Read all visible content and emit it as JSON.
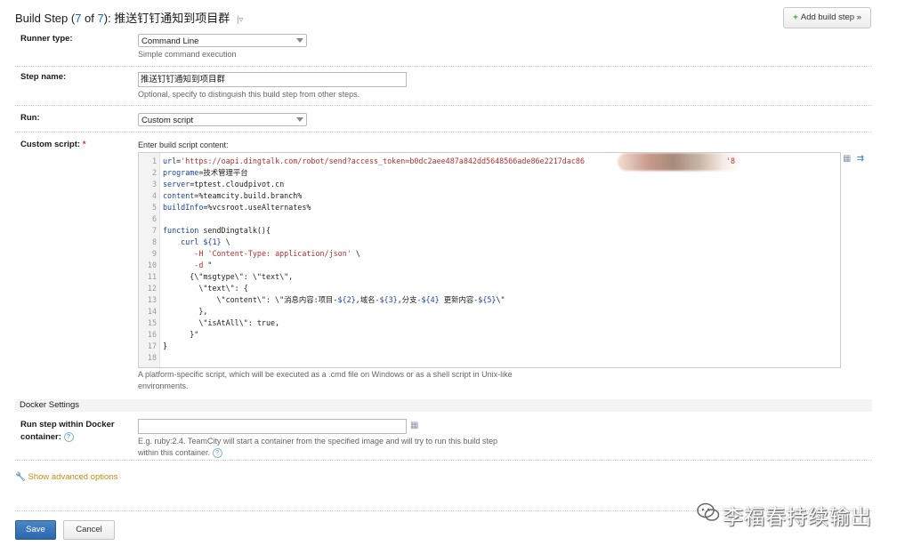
{
  "header": {
    "title_prefix": "Build Step (",
    "step_num": "7",
    "title_of": " of ",
    "step_total": "7",
    "title_suffix": "): 推送钉钉通知到项目群",
    "add_step_label": "Add build step »"
  },
  "runner": {
    "label": "Runner type:",
    "value": "Command Line",
    "hint": "Simple command execution"
  },
  "step_name": {
    "label": "Step name:",
    "value": "推送钉钉通知到项目群",
    "hint": "Optional, specify to distinguish this build step from other steps."
  },
  "run": {
    "label": "Run:",
    "value": "Custom script"
  },
  "script": {
    "label": "Custom script:",
    "required_mark": "*",
    "hint_top": "Enter build script content:",
    "hint_bottom_1": "A platform-specific script, which will be executed as a .cmd file on Windows or as a shell script in Unix-like",
    "hint_bottom_2": "environments.",
    "lines": [
      {
        "n": "1",
        "t": "url='https://oapi.dingtalk.com/robot/send?access_token=b0dc2aee487a842dd5648566ade86e2217dac86"
      },
      {
        "n": "2",
        "t": "programe=技术管理平台"
      },
      {
        "n": "3",
        "t": "server=tptest.cloudpivot.cn"
      },
      {
        "n": "4",
        "t": "content=%teamcity.build.branch%"
      },
      {
        "n": "5",
        "t": "buildInfo=%vcsroot.useAlternates%"
      },
      {
        "n": "6",
        "t": ""
      },
      {
        "n": "7",
        "t": "function sendDingtalk(){"
      },
      {
        "n": "8",
        "t": "    curl ${1} \\"
      },
      {
        "n": "9",
        "t": "       -H 'Content-Type: application/json' \\"
      },
      {
        "n": "10",
        "t": "       -d \""
      },
      {
        "n": "11",
        "t": "      {\\\"msgtype\\\": \\\"text\\\","
      },
      {
        "n": "12",
        "t": "        \\\"text\\\": {"
      },
      {
        "n": "13",
        "t": "            \\\"content\\\": \\\"消息内容:项目-${2},域名-${3},分支-${4} 更新内容-${5}\\\""
      },
      {
        "n": "14",
        "t": "        },"
      },
      {
        "n": "15",
        "t": "        \\\"isAtAll\\\": true,"
      },
      {
        "n": "16",
        "t": "      }\""
      },
      {
        "n": "17",
        "t": "}"
      },
      {
        "n": "18",
        "t": ""
      }
    ],
    "line1_tail": "'8"
  },
  "docker": {
    "section": "Docker Settings",
    "label_1": "Run step within Docker",
    "label_2": "container:",
    "hint_1": "E.g. ruby:2.4. TeamCity will start a container from the specified image and will try to run this build step",
    "hint_2": "within this container."
  },
  "advanced": {
    "label": "Show advanced options"
  },
  "actions": {
    "save": "Save",
    "cancel": "Cancel"
  },
  "watermark": {
    "text": "李福春持续输出"
  },
  "icons": {
    "add": "plus-icon",
    "menu": "chevron-down-icon",
    "wrench": "wrench-icon",
    "help": "help-icon",
    "expand": "expand-icon",
    "wrap": "wrap-icon"
  },
  "colors": {
    "accent": "#0d6fb0",
    "save": "#2c66ad",
    "advanced": "#c98d10",
    "required": "#d32f2f"
  }
}
